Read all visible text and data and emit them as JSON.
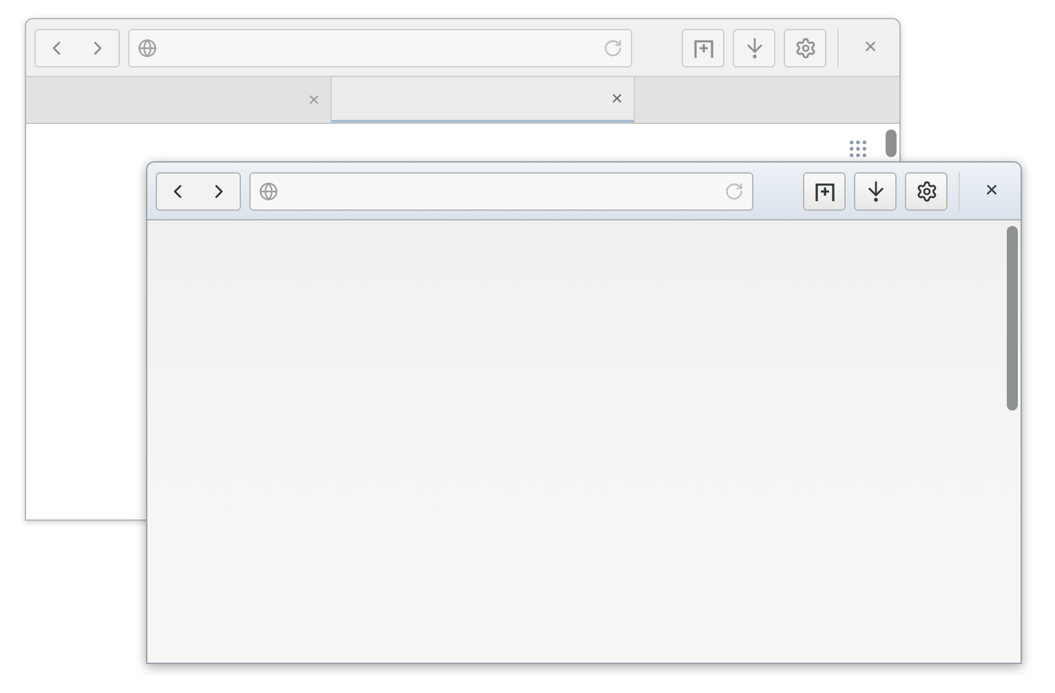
{
  "windows": [
    {
      "active": false,
      "close": "×",
      "tabs": [
        {
          "selected": false,
          "close": "×"
        },
        {
          "selected": true,
          "close": "×"
        }
      ]
    },
    {
      "active": true,
      "close": "×"
    }
  ]
}
